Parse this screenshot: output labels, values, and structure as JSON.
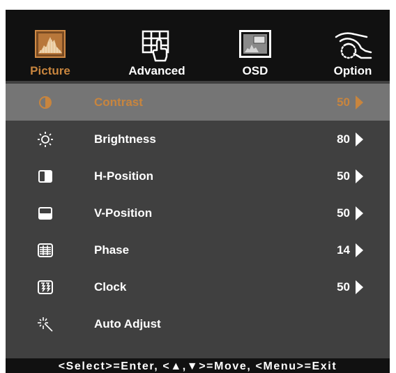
{
  "tabs": [
    {
      "label": "Picture",
      "icon": "picture-icon",
      "active": true
    },
    {
      "label": "Advanced",
      "icon": "advanced-grid-icon",
      "active": false
    },
    {
      "label": "OSD",
      "icon": "osd-icon",
      "active": false
    },
    {
      "label": "Option",
      "icon": "option-hand-icon",
      "active": false
    }
  ],
  "items": [
    {
      "label": "Contrast",
      "value": "50",
      "icon": "contrast-icon",
      "active": true
    },
    {
      "label": "Brightness",
      "value": "80",
      "icon": "brightness-icon",
      "active": false
    },
    {
      "label": "H-Position",
      "value": "50",
      "icon": "h-position-icon",
      "active": false
    },
    {
      "label": "V-Position",
      "value": "50",
      "icon": "v-position-icon",
      "active": false
    },
    {
      "label": "Phase",
      "value": "14",
      "icon": "phase-icon",
      "active": false
    },
    {
      "label": "Clock",
      "value": "50",
      "icon": "clock-icon",
      "active": false
    },
    {
      "label": "Auto Adjust",
      "value": "",
      "icon": "auto-adjust-icon",
      "active": false
    }
  ],
  "footer": "<Select>=Enter, <▲,▼>=Move, <Menu>=Exit",
  "colors": {
    "accent": "#c8853e",
    "panel": "#404040",
    "selected_row": "#757575",
    "header": "#111111"
  }
}
